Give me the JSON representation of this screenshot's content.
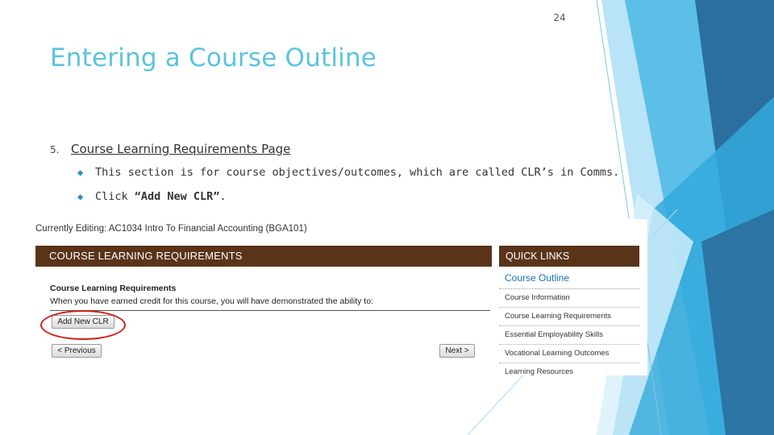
{
  "slide": {
    "number": "24",
    "title": "Entering a Course Outline",
    "step_number": "5.",
    "step_heading": "Course Learning Requirements Page",
    "bullets": [
      "This section is for course objectives/outcomes, which are called CLR’s in Comms.",
      {
        "before": "Click ",
        "bold": "“Add New CLR”",
        "after": "."
      }
    ],
    "bullet_icon": "diamond-bullet-icon",
    "colors": {
      "title": "#5bc3e0",
      "accent_dark": "#2b6f9e",
      "accent_mid": "#32a9dc",
      "accent_light": "#a9dcf4"
    }
  },
  "screenshot": {
    "editing_label": "Currently Editing: AC1034 Intro To Financial Accounting (BGA101)",
    "panel_title": "COURSE LEARNING REQUIREMENTS",
    "section_title": "Course Learning Requirements",
    "section_description": "When you have earned credit for this course, you will have demonstrated the ability to:",
    "add_button": "Add New CLR",
    "prev_button": "< Previous",
    "next_button": "Next >",
    "header_color": "#5a3419",
    "quick_links": {
      "title": "QUICK LINKS",
      "items": [
        "Course Outline",
        "Course Information",
        "Course Learning Requirements",
        "Essential Employability Skills",
        "Vocational Learning Outcomes",
        "Learning Resources"
      ]
    }
  }
}
